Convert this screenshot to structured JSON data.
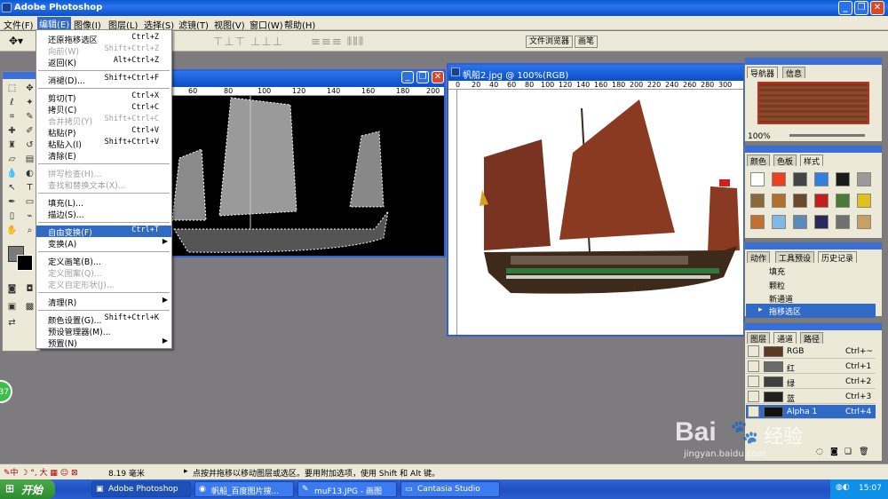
{
  "app": {
    "title": "Adobe Photoshop",
    "min": "_",
    "restore": "❐",
    "close": "✕"
  },
  "menubar": [
    {
      "label": "文件(F)",
      "name": "file"
    },
    {
      "label": "编辑(E)",
      "name": "edit"
    },
    {
      "label": "图像(I)",
      "name": "image"
    },
    {
      "label": "图层(L)",
      "name": "layer"
    },
    {
      "label": "选择(S)",
      "name": "select"
    },
    {
      "label": "滤镜(T)",
      "name": "filter"
    },
    {
      "label": "视图(V)",
      "name": "view"
    },
    {
      "label": "窗口(W)",
      "name": "window"
    },
    {
      "label": "帮助(H)",
      "name": "help"
    }
  ],
  "optbar": {
    "file_browser": "文件浏览器",
    "brushes": "画笔"
  },
  "edit_menu": [
    {
      "label": "还原拖移选区",
      "shortcut": "Ctrl+Z",
      "state": "normal"
    },
    {
      "label": "向前(W)",
      "shortcut": "Shift+Ctrl+Z",
      "state": "disabled"
    },
    {
      "label": "返回(K)",
      "shortcut": "Alt+Ctrl+Z",
      "state": "normal"
    },
    {
      "sep": true
    },
    {
      "label": "消褪(D)...",
      "shortcut": "Shift+Ctrl+F",
      "state": "normal"
    },
    {
      "sep": true
    },
    {
      "label": "剪切(T)",
      "shortcut": "Ctrl+X",
      "state": "normal"
    },
    {
      "label": "拷贝(C)",
      "shortcut": "Ctrl+C",
      "state": "normal"
    },
    {
      "label": "合并拷贝(Y)",
      "shortcut": "Shift+Ctrl+C",
      "state": "disabled"
    },
    {
      "label": "粘贴(P)",
      "shortcut": "Ctrl+V",
      "state": "normal"
    },
    {
      "label": "粘贴入(I)",
      "shortcut": "Shift+Ctrl+V",
      "state": "normal"
    },
    {
      "label": "清除(E)",
      "shortcut": "",
      "state": "normal"
    },
    {
      "sep": true
    },
    {
      "label": "拼写检查(H)...",
      "shortcut": "",
      "state": "disabled"
    },
    {
      "label": "查找和替换文本(X)...",
      "shortcut": "",
      "state": "disabled"
    },
    {
      "sep": true
    },
    {
      "label": "填充(L)...",
      "shortcut": "",
      "state": "normal"
    },
    {
      "label": "描边(S)...",
      "shortcut": "",
      "state": "normal"
    },
    {
      "sep": true
    },
    {
      "label": "自由变换(F)",
      "shortcut": "Ctrl+T",
      "state": "highlight"
    },
    {
      "label": "变换(A)",
      "shortcut": "",
      "state": "normal",
      "submenu": true
    },
    {
      "sep": true
    },
    {
      "label": "定义画笔(B)...",
      "shortcut": "",
      "state": "normal"
    },
    {
      "label": "定义图案(Q)...",
      "shortcut": "",
      "state": "disabled"
    },
    {
      "label": "定义自定形状(J)...",
      "shortcut": "",
      "state": "disabled"
    },
    {
      "sep": true
    },
    {
      "label": "清理(R)",
      "shortcut": "",
      "state": "normal",
      "submenu": true
    },
    {
      "sep": true
    },
    {
      "label": "颜色设置(G)...",
      "shortcut": "Shift+Ctrl+K",
      "state": "normal"
    },
    {
      "label": "预设管理器(M)...",
      "shortcut": "",
      "state": "normal"
    },
    {
      "label": "预置(N)",
      "shortcut": "",
      "state": "normal",
      "submenu": true
    }
  ],
  "doc_left": {
    "ruler_ticks": [
      "60",
      "80",
      "100",
      "120",
      "140",
      "160",
      "180",
      "200"
    ]
  },
  "doc_right": {
    "title": "帆船2.jpg @ 100%(RGB)",
    "ruler_ticks": [
      "0",
      "20",
      "40",
      "60",
      "80",
      "100",
      "120",
      "140",
      "160",
      "180",
      "200",
      "220",
      "240",
      "260",
      "280",
      "300"
    ]
  },
  "navigator": {
    "tabs": [
      "导航器",
      "信息"
    ],
    "zoom": "100%"
  },
  "swatches": {
    "tabs": [
      "颜色",
      "色板",
      "样式"
    ]
  },
  "history": {
    "tabs": [
      "动作",
      "工具预设",
      "历史记录"
    ],
    "items": [
      "填充",
      "颗粒",
      "新通道",
      "拖移选区"
    ]
  },
  "channels": {
    "tabs": [
      "图层",
      "通道",
      "路径"
    ],
    "items": [
      {
        "name": "RGB",
        "shortcut": "Ctrl+~"
      },
      {
        "name": "红",
        "shortcut": "Ctrl+1"
      },
      {
        "name": "绿",
        "shortcut": "Ctrl+2"
      },
      {
        "name": "蓝",
        "shortcut": "Ctrl+3"
      },
      {
        "name": "Alpha 1",
        "shortcut": "Ctrl+4"
      }
    ]
  },
  "status": {
    "zoom": "8.19 毫米",
    "hint": "点按并拖移以移动图层或选区。要用附加选项，使用 Shift 和 Alt 键。"
  },
  "taskbar": {
    "start": "开始",
    "tasks": [
      "Adobe Photoshop",
      "帆船_百度图片搜...",
      "muF13.JPG - 画图",
      "Cantasia Studio"
    ],
    "clock": "15:07"
  },
  "watermark": {
    "brand": "Bai",
    "brand2": "经验",
    "url": "jingyan.baidu.com"
  },
  "badge": "37",
  "colors": {
    "titlebar": "#0b4fc8",
    "menu_highlight": "#316ac5",
    "sail": "#8b3a22",
    "workspace": "#7d7b7e"
  }
}
